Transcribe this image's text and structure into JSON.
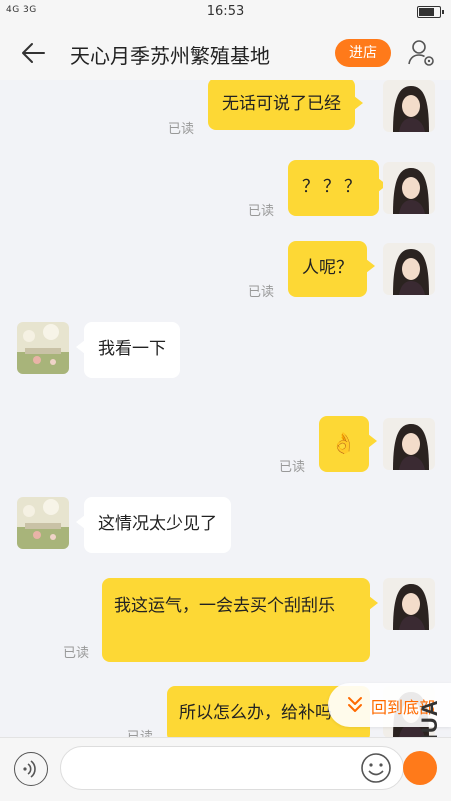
{
  "status_bar": {
    "network": "4G 3G",
    "time": "16:53"
  },
  "header": {
    "title": "天心月季苏州繁殖基地",
    "shop_label": "进店"
  },
  "messages": [
    {
      "from": "me",
      "text": "无话可说了已经",
      "read": "已读"
    },
    {
      "from": "me",
      "text": "？？？",
      "read": "已读"
    },
    {
      "from": "me",
      "text": "人呢？",
      "read": "已读"
    },
    {
      "from": "them",
      "text": "我看一下"
    },
    {
      "from": "me",
      "text": "👌",
      "read": "已读"
    },
    {
      "from": "them",
      "text": "这情况太少见了"
    },
    {
      "from": "me",
      "text": "我这运气，一会去买个刮刮乐",
      "read": "已读"
    },
    {
      "from": "me",
      "text": "所以怎么办，给补吗",
      "read": "已读"
    }
  ],
  "back_to_bottom": {
    "label": "回到底部"
  },
  "watermark": "MSHUA",
  "colors": {
    "accent": "#ff7a1a",
    "my_bubble": "#fdd835",
    "their_bubble": "#ffffff",
    "background": "#f2f3f7"
  }
}
